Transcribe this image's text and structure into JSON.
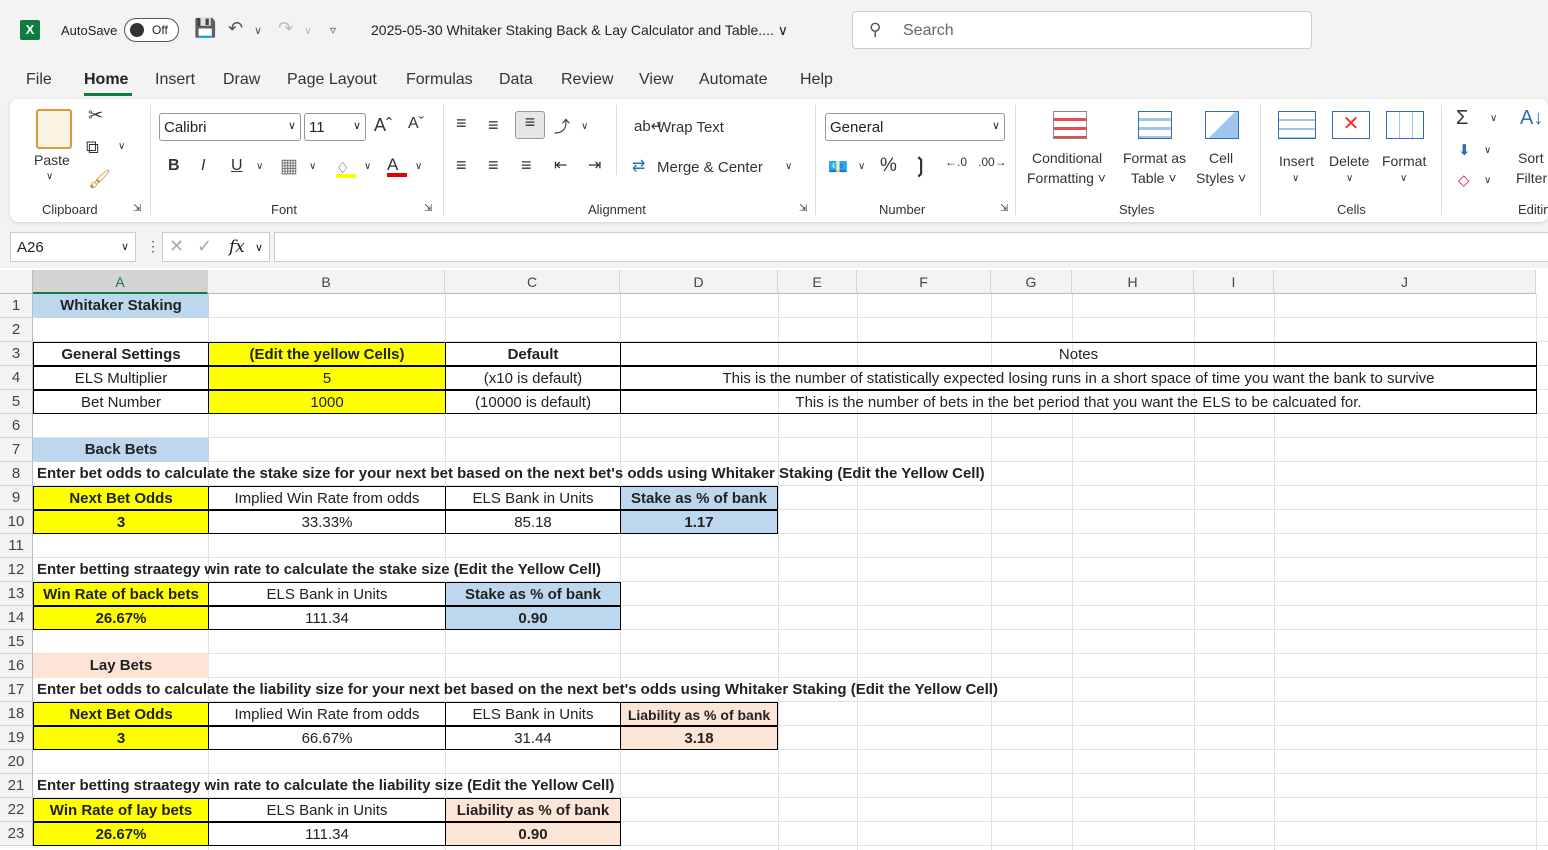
{
  "titlebar": {
    "autosave_label": "AutoSave",
    "toggle_state": "Off",
    "doc_title": "2025-05-30 Whitaker Staking Back & Lay Calculator and Table.... ∨",
    "search_placeholder": "Search"
  },
  "menu": [
    "File",
    "Home",
    "Insert",
    "Draw",
    "Page Layout",
    "Formulas",
    "Data",
    "Review",
    "View",
    "Automate",
    "Help"
  ],
  "ribbon": {
    "paste": "Paste",
    "clipboard": "Clipboard",
    "font_name": "Calibri",
    "font_size": "11",
    "font": "Font",
    "bold": "B",
    "italic": "I",
    "underline": "U",
    "wrap_text": "Wrap Text",
    "merge_center": "Merge & Center",
    "alignment": "Alignment",
    "number_format": "General",
    "number": "Number",
    "cond_fmt_1": "Conditional",
    "cond_fmt_2": "Formatting ˅",
    "fmt_table_1": "Format as",
    "fmt_table_2": "Table ˅",
    "cell_styles_1": "Cell",
    "cell_styles_2": "Styles ˅",
    "styles": "Styles",
    "insert": "Insert",
    "delete": "Delete",
    "format": "Format",
    "cells": "Cells",
    "sort_1": "Sort",
    "sort_2": "Filter",
    "editing": "Editin"
  },
  "formula_bar": {
    "name_box": "A26",
    "fx": "fx",
    "formula": ""
  },
  "columns": [
    "A",
    "B",
    "C",
    "D",
    "E",
    "F",
    "G",
    "H",
    "I",
    "J"
  ],
  "rows": [
    "1",
    "2",
    "3",
    "4",
    "5",
    "6",
    "7",
    "8",
    "9",
    "10",
    "11",
    "12",
    "13",
    "14",
    "15",
    "16",
    "17",
    "18",
    "19",
    "20",
    "21",
    "22",
    "23"
  ],
  "cells": {
    "a1": "Whitaker Staking",
    "a3": "General Settings",
    "b3": "(Edit the yellow Cells)",
    "c3": "Default",
    "notes_hdr": "Notes",
    "a4": "ELS Multiplier",
    "b4": "5",
    "c4": "(x10 is default)",
    "notes4": "This is the number of statistically expected losing runs in a short space of time you want the bank to survive",
    "a5": "Bet Number",
    "b5": "1000",
    "c5": "(10000 is default)",
    "notes5": "This is the number of bets in the bet period that you want the ELS to be calcuated for.",
    "a7": "Back Bets",
    "a8": "Enter bet odds to calculate the stake size for your next bet based on the next bet's odds using Whitaker  Staking  (Edit the Yellow Cell)",
    "a9": "Next Bet Odds",
    "b9": "Implied Win Rate from odds",
    "c9": "ELS Bank in Units",
    "d9": "Stake as % of bank",
    "a10": "3",
    "b10": "33.33%",
    "c10": "85.18",
    "d10": "1.17",
    "a12": "Enter betting straategy win rate to calculate the stake size (Edit the Yellow Cell)",
    "a13": "Win Rate of back bets",
    "b13": "ELS Bank in Units",
    "c13": "Stake as % of bank",
    "a14": "26.67%",
    "b14": "111.34",
    "c14": "0.90",
    "a16": "Lay Bets",
    "a17": "Enter bet odds to calculate the liability size for your next bet based on the next bet's odds using Whitaker  Staking  (Edit the Yellow Cell)",
    "a18": "Next Bet Odds",
    "b18": "Implied Win Rate from odds",
    "c18": "ELS Bank in Units",
    "d18": "Liability as % of bank",
    "a19": "3",
    "b19": "66.67%",
    "c19": "31.44",
    "d19": "3.18",
    "a21": "Enter betting straategy win rate to calculate the liability size (Edit the Yellow Cell)",
    "a22": "Win Rate of lay bets",
    "b22": "ELS Bank in Units",
    "c22": "Liability as % of bank",
    "a23": "26.67%",
    "b23": "111.34",
    "c23": "0.90"
  },
  "colors": {
    "excel_green": "#107c41",
    "yellow": "#ffff00",
    "blue": "#bdd7ee",
    "peach": "#fce4d6"
  }
}
